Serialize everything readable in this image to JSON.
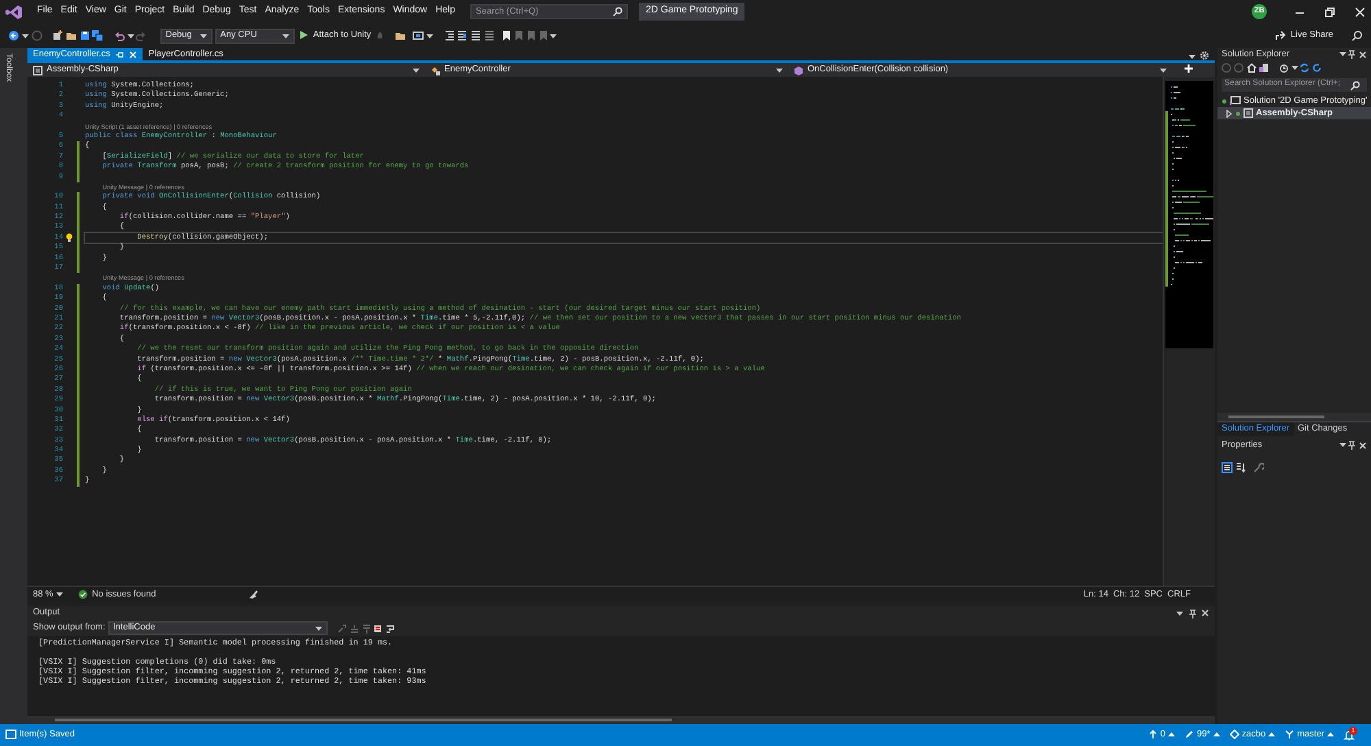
{
  "menu": [
    "File",
    "Edit",
    "View",
    "Git",
    "Project",
    "Build",
    "Debug",
    "Test",
    "Analyze",
    "Tools",
    "Extensions",
    "Window",
    "Help"
  ],
  "search": {
    "placeholder": "Search (Ctrl+Q)"
  },
  "solution_name": "2D Game Prototyping",
  "account": {
    "initials": "ZB"
  },
  "toolbar": {
    "configuration": "Debug",
    "platform": "Any CPU",
    "run": "Attach to Unity",
    "live_share": "Live Share"
  },
  "toolbox": {
    "label": "Toolbox"
  },
  "doc_tabs": [
    {
      "label": "EnemyController.cs",
      "selected": true
    },
    {
      "label": "PlayerController.cs",
      "selected": false
    }
  ],
  "nav_bar": {
    "project": "Assembly-CSharp",
    "type": "EnemyController",
    "member": "OnCollisionEnter(Collision collision)"
  },
  "editor": {
    "lines": [
      {
        "n": "1",
        "current": false,
        "modified": false,
        "segs": [
          {
            "kind": "k",
            "text": "using"
          },
          {
            "kind": "p",
            "text": " System.Collections;"
          }
        ]
      },
      {
        "n": "2",
        "current": false,
        "modified": false,
        "segs": [
          {
            "kind": "k",
            "text": "using"
          },
          {
            "kind": "p",
            "text": " System.Collections.Generic;"
          }
        ]
      },
      {
        "n": "3",
        "current": false,
        "modified": false,
        "segs": [
          {
            "kind": "k",
            "text": "using"
          },
          {
            "kind": "p",
            "text": " UnityEngine;"
          }
        ]
      },
      {
        "n": "4",
        "current": false,
        "modified": false
      },
      {
        "n": "5",
        "current": false,
        "modified": false,
        "lens": "Unity Script (1 asset reference) | 0 references",
        "segs": [
          {
            "kind": "k",
            "text": "public class "
          },
          {
            "kind": "t",
            "text": "EnemyController"
          },
          {
            "kind": "p",
            "text": " : "
          },
          {
            "kind": "t",
            "text": "MonoBehaviour"
          }
        ]
      },
      {
        "n": "6",
        "current": false,
        "modified": true,
        "segs": [
          {
            "kind": "p",
            "text": "{"
          }
        ]
      },
      {
        "n": "7",
        "current": false,
        "modified": true,
        "segs": [
          {
            "kind": "p",
            "text": "    ["
          },
          {
            "kind": "t",
            "text": "SerializeField"
          },
          {
            "kind": "p",
            "text": "] "
          },
          {
            "kind": "c",
            "text": "// we serialize our data to store for later"
          }
        ]
      },
      {
        "n": "8",
        "current": false,
        "modified": true,
        "segs": [
          {
            "kind": "k",
            "text": "    private "
          },
          {
            "kind": "t",
            "text": "Transform"
          },
          {
            "kind": "p",
            "text": " posA, posB; "
          },
          {
            "kind": "c",
            "text": "// create 2 transform position for enemy to go towards"
          }
        ]
      },
      {
        "n": "9",
        "current": false,
        "modified": true
      },
      {
        "n": "10",
        "current": false,
        "modified": true,
        "lens": "Unity Message | 0 references",
        "segs": [
          {
            "kind": "k",
            "text": "    private void "
          },
          {
            "kind": "t",
            "text": "OnCollisionEnter"
          },
          {
            "kind": "p",
            "text": "("
          },
          {
            "kind": "t",
            "text": "Collision"
          },
          {
            "kind": "p",
            "text": " collision)"
          }
        ]
      },
      {
        "n": "11",
        "current": false,
        "modified": true,
        "segs": [
          {
            "kind": "p",
            "text": "    {"
          }
        ]
      },
      {
        "n": "12",
        "current": false,
        "modified": true,
        "segs": [
          {
            "kind": "f",
            "text": "        if"
          },
          {
            "kind": "p",
            "text": "(collision.collider.name == "
          },
          {
            "kind": "s",
            "text": "\"Player\""
          },
          {
            "kind": "p",
            "text": ")"
          }
        ]
      },
      {
        "n": "13",
        "current": false,
        "modified": true,
        "segs": [
          {
            "kind": "p",
            "text": "        {"
          }
        ]
      },
      {
        "n": "14",
        "current": true,
        "modified": true,
        "segs": [
          {
            "kind": "m",
            "text": "            Destroy"
          },
          {
            "kind": "p",
            "text": "(collision.gameObject);"
          }
        ]
      },
      {
        "n": "15",
        "current": false,
        "modified": true,
        "segs": [
          {
            "kind": "p",
            "text": "        }"
          }
        ]
      },
      {
        "n": "16",
        "current": false,
        "modified": true,
        "segs": [
          {
            "kind": "p",
            "text": "    }"
          }
        ]
      },
      {
        "n": "17",
        "current": false,
        "modified": true
      },
      {
        "n": "18",
        "current": false,
        "modified": true,
        "lens": "Unity Message | 0 references",
        "segs": [
          {
            "kind": "k",
            "text": "    void "
          },
          {
            "kind": "t",
            "text": "Update"
          },
          {
            "kind": "p",
            "text": "()"
          }
        ]
      },
      {
        "n": "19",
        "current": false,
        "modified": true,
        "segs": [
          {
            "kind": "p",
            "text": "    {"
          }
        ]
      },
      {
        "n": "20",
        "current": false,
        "modified": true,
        "segs": [
          {
            "kind": "c",
            "text": "        // for this example, we can have our enemy path start immedietly using a method of desination - start (our desired target minus our start position)"
          }
        ]
      },
      {
        "n": "21",
        "current": false,
        "modified": true,
        "segs": [
          {
            "kind": "p",
            "text": "        transform.position = "
          },
          {
            "kind": "k",
            "text": "new "
          },
          {
            "kind": "t",
            "text": "Vector3"
          },
          {
            "kind": "p",
            "text": "(posB.position.x - posA.position.x * "
          },
          {
            "kind": "t",
            "text": "Time"
          },
          {
            "kind": "p",
            "text": ".time * 5,-2.11f,0); "
          },
          {
            "kind": "c",
            "text": "// we then set our position to a new vector3 that passes in our start position minus our desination"
          }
        ]
      },
      {
        "n": "22",
        "current": false,
        "modified": true,
        "segs": [
          {
            "kind": "f",
            "text": "        if"
          },
          {
            "kind": "p",
            "text": "(transform.position.x < -8f) "
          },
          {
            "kind": "c",
            "text": "// like in the previous article, we check if our position is < a value"
          }
        ]
      },
      {
        "n": "23",
        "current": false,
        "modified": true,
        "segs": [
          {
            "kind": "p",
            "text": "        {"
          }
        ]
      },
      {
        "n": "24",
        "current": false,
        "modified": true,
        "segs": [
          {
            "kind": "c",
            "text": "            // we the reset our transform position again and utilize the Ping Pong method, to go back in the opposite direction"
          }
        ]
      },
      {
        "n": "25",
        "current": false,
        "modified": true,
        "segs": [
          {
            "kind": "p",
            "text": "            transform.position = "
          },
          {
            "kind": "k",
            "text": "new "
          },
          {
            "kind": "t",
            "text": "Vector3"
          },
          {
            "kind": "p",
            "text": "(posA.position.x "
          },
          {
            "kind": "c",
            "text": "/** Time.time * 2*/"
          },
          {
            "kind": "p",
            "text": " * "
          },
          {
            "kind": "t",
            "text": "Mathf"
          },
          {
            "kind": "p",
            "text": ".PingPong("
          },
          {
            "kind": "t",
            "text": "Time"
          },
          {
            "kind": "p",
            "text": ".time, 2) - posB.position.x, -2.11f, 0);"
          }
        ]
      },
      {
        "n": "26",
        "current": false,
        "modified": true,
        "segs": [
          {
            "kind": "f",
            "text": "            if"
          },
          {
            "kind": "p",
            "text": " (transform.position.x <= -8f || transform.position.x >= 14f) "
          },
          {
            "kind": "c",
            "text": "// when we reach our desination, we can check again if our position is > a value"
          }
        ]
      },
      {
        "n": "27",
        "current": false,
        "modified": true,
        "segs": [
          {
            "kind": "p",
            "text": "            {"
          }
        ]
      },
      {
        "n": "28",
        "current": false,
        "modified": true,
        "segs": [
          {
            "kind": "c",
            "text": "                // if this is true, we want to Ping Pong our position again"
          }
        ]
      },
      {
        "n": "29",
        "current": false,
        "modified": true,
        "segs": [
          {
            "kind": "p",
            "text": "                transform.position = "
          },
          {
            "kind": "k",
            "text": "new "
          },
          {
            "kind": "t",
            "text": "Vector3"
          },
          {
            "kind": "p",
            "text": "(posB.position.x * "
          },
          {
            "kind": "t",
            "text": "Mathf"
          },
          {
            "kind": "p",
            "text": ".PingPong("
          },
          {
            "kind": "t",
            "text": "Time"
          },
          {
            "kind": "p",
            "text": ".time, 2) - posA.position.x * 10, -2.11f, 0);"
          }
        ]
      },
      {
        "n": "30",
        "current": false,
        "modified": true,
        "segs": [
          {
            "kind": "p",
            "text": "            }"
          }
        ]
      },
      {
        "n": "31",
        "current": false,
        "modified": true,
        "segs": [
          {
            "kind": "f",
            "text": "            else if"
          },
          {
            "kind": "p",
            "text": "(transform.position.x < 14f)"
          }
        ]
      },
      {
        "n": "32",
        "current": false,
        "modified": true,
        "segs": [
          {
            "kind": "p",
            "text": "            {"
          }
        ]
      },
      {
        "n": "33",
        "current": false,
        "modified": true,
        "segs": [
          {
            "kind": "p",
            "text": "                transform.position = "
          },
          {
            "kind": "k",
            "text": "new "
          },
          {
            "kind": "t",
            "text": "Vector3"
          },
          {
            "kind": "p",
            "text": "(posB.position.x - posA.position.x * "
          },
          {
            "kind": "t",
            "text": "Time"
          },
          {
            "kind": "p",
            "text": ".time, -2.11f, 0);"
          }
        ]
      },
      {
        "n": "34",
        "current": false,
        "modified": true,
        "segs": [
          {
            "kind": "p",
            "text": "            }"
          }
        ]
      },
      {
        "n": "35",
        "current": false,
        "modified": true,
        "segs": [
          {
            "kind": "p",
            "text": "        }"
          }
        ]
      },
      {
        "n": "36",
        "current": false,
        "modified": true,
        "segs": [
          {
            "kind": "p",
            "text": "    }"
          }
        ]
      },
      {
        "n": "37",
        "current": false,
        "modified": true,
        "segs": [
          {
            "kind": "p",
            "text": "}"
          }
        ]
      }
    ]
  },
  "editor_status": {
    "zoom": "88 %",
    "issues": "No issues found",
    "line": "Ln: 14",
    "column": "Ch: 12",
    "whitespace": "SPC",
    "line_endings": "CRLF"
  },
  "output": {
    "title": "Output",
    "source_label": "Show output from:",
    "source": "IntelliCode",
    "blocks": [
      {
        "lines": [
          "[PredictionManagerService I] Semantic model processing finished in 19 ms."
        ]
      },
      {
        "lines": [
          "[VSIX I] Suggestion completions (0) did take: 0ms",
          "[VSIX I] Suggestion filter, incomming suggestion 2, returned 2, time taken: 41ms",
          "[VSIX I] Suggestion filter, incomming suggestion 2, returned 2, time taken: 93ms"
        ]
      }
    ]
  },
  "solution_explorer": {
    "title": "Solution Explorer",
    "search_placeholder": "Search Solution Explorer (Ctrl+;",
    "tree": [
      {
        "label": "Solution '2D Game Prototyping'",
        "selected": false,
        "children": [
          {
            "label": "Assembly-CSharp",
            "selected": true
          }
        ]
      }
    ],
    "tabs": [
      {
        "label": "Solution Explorer",
        "selected": true
      },
      {
        "label": "Git Changes",
        "selected": false
      }
    ]
  },
  "properties": {
    "title": "Properties"
  },
  "status_bar": {
    "message": "Item(s) Saved",
    "push": "0",
    "changes": "99*",
    "user": "zacbo",
    "branch": "master",
    "notifications": "1"
  }
}
